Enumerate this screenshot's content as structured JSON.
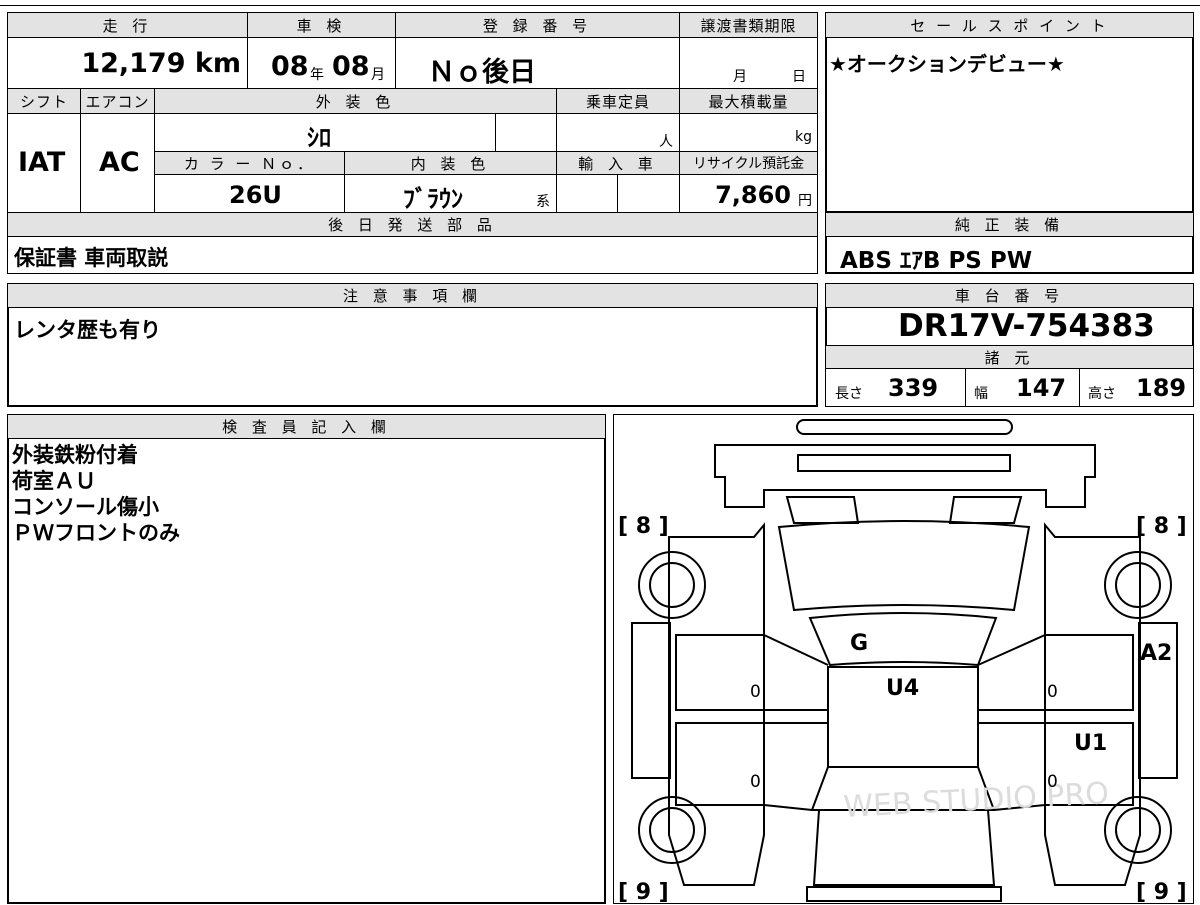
{
  "top_table": {
    "mileage": {
      "header": "走 行",
      "value": "12,179 km"
    },
    "inspection": {
      "header": "車 検",
      "year": "08",
      "year_unit": "年",
      "month": "08",
      "month_unit": "月"
    },
    "registration": {
      "header": "登 録 番 号",
      "value": "Ｎｏ後日"
    },
    "transfer_deadline": {
      "header": "譲渡書類期限",
      "month_unit": "月",
      "day_unit": "日"
    },
    "shift": {
      "header": "シフト",
      "value": "IAT"
    },
    "aircon": {
      "header": "エアコン",
      "value": "AC"
    },
    "exterior_color": {
      "header": "外 装 色",
      "value": "ｼﾛ"
    },
    "capacity": {
      "header": "乗車定員",
      "unit": "人"
    },
    "max_load": {
      "header": "最大積載量",
      "unit": "kg"
    },
    "color_no": {
      "header": "カ ラ ー Ｎｏ．",
      "value": "26U"
    },
    "interior_color": {
      "header": "内 装 色",
      "value": "ﾌﾞﾗｳﾝ",
      "suffix": "系"
    },
    "import": {
      "header": "輸 入 車"
    },
    "recycle": {
      "header": "リサイクル預託金",
      "value": "7,860",
      "unit": "円"
    },
    "later_parts": {
      "header": "後 日 発 送 部 品",
      "value": "保証書 車両取説"
    }
  },
  "sales_point": {
    "header": "セ ー ル ス ポ イ ン ト",
    "value": "★オークションデビュー★"
  },
  "genuine_equipment": {
    "header": "純 正 装 備",
    "value": "ABS ｴｱB PS PW"
  },
  "notes": {
    "header": "注 意 事 項 欄",
    "value": "レンタ歴も有り"
  },
  "chassis": {
    "header": "車 台 番 号",
    "value": "DR17V-754383",
    "specs_header": "諸 元",
    "length_label": "長さ",
    "length": "339",
    "width_label": "幅",
    "width": "147",
    "height_label": "高さ",
    "height": "189"
  },
  "inspector": {
    "header": "検 査 員 記 入 欄",
    "lines": [
      "外装鉄粉付着",
      "荷室ＡＵ",
      "コンソール傷小",
      "ＰＷフロントのみ"
    ]
  },
  "diagram": {
    "tire_fl": "[ 8 ]",
    "tire_fr": "[ 8 ]",
    "tire_rl": "[ 9 ]",
    "tire_rr": "[ 9 ]",
    "mark_windshield": "G",
    "mark_roof": "U4",
    "mark_right_front": "A2",
    "mark_right_rear": "U1",
    "door_l1": "0",
    "door_l2": "0",
    "door_r1": "0",
    "door_r2": "0",
    "watermark": "WEB STUDIO PRO"
  }
}
